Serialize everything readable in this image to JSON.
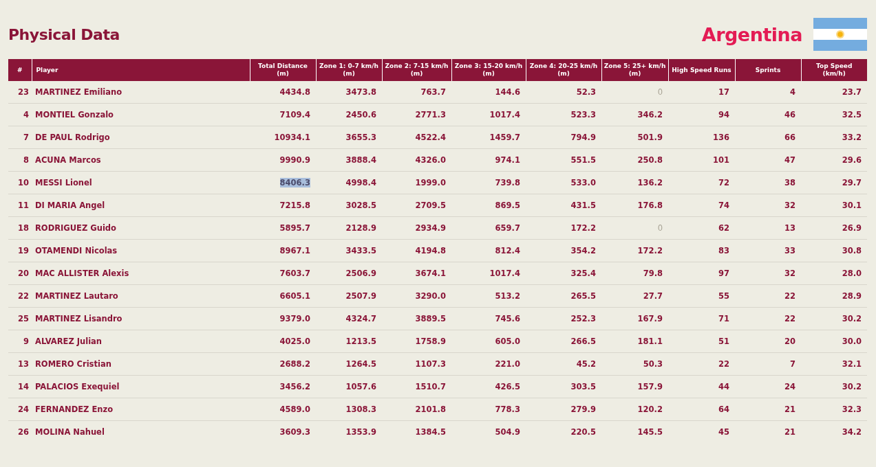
{
  "title": "Physical Data",
  "team": {
    "name": "Argentina"
  },
  "table": {
    "columns": [
      "#",
      "Player",
      "Total Distance\n(m)",
      "Zone 1: 0-7 km/h\n(m)",
      "Zone 2: 7-15 km/h\n(m)",
      "Zone 3: 15-20 km/h\n(m)",
      "Zone 4: 20-25 km/h\n(m)",
      "Zone 5: 25+ km/h\n(m)",
      "High Speed Runs",
      "Sprints",
      "Top Speed\n(km/h)"
    ],
    "rows": [
      {
        "number": "23",
        "player": "MARTINEZ Emiliano",
        "values": [
          "4434.8",
          "3473.8",
          "763.7",
          "144.6",
          "52.3",
          "0",
          "17",
          "4",
          "23.7"
        ],
        "zone5_faded": true,
        "total_selected": false
      },
      {
        "number": "4",
        "player": "MONTIEL Gonzalo",
        "values": [
          "7109.4",
          "2450.6",
          "2771.3",
          "1017.4",
          "523.3",
          "346.2",
          "94",
          "46",
          "32.5"
        ],
        "zone5_faded": false,
        "total_selected": false
      },
      {
        "number": "7",
        "player": "DE PAUL Rodrigo",
        "values": [
          "10934.1",
          "3655.3",
          "4522.4",
          "1459.7",
          "794.9",
          "501.9",
          "136",
          "66",
          "33.2"
        ],
        "zone5_faded": false,
        "total_selected": false
      },
      {
        "number": "8",
        "player": "ACUNA Marcos",
        "values": [
          "9990.9",
          "3888.4",
          "4326.0",
          "974.1",
          "551.5",
          "250.8",
          "101",
          "47",
          "29.6"
        ],
        "zone5_faded": false,
        "total_selected": false
      },
      {
        "number": "10",
        "player": "MESSI Lionel",
        "values": [
          "8406.3",
          "4998.4",
          "1999.0",
          "739.8",
          "533.0",
          "136.2",
          "72",
          "38",
          "29.7"
        ],
        "zone5_faded": false,
        "total_selected": true
      },
      {
        "number": "11",
        "player": "DI MARIA Angel",
        "values": [
          "7215.8",
          "3028.5",
          "2709.5",
          "869.5",
          "431.5",
          "176.8",
          "74",
          "32",
          "30.1"
        ],
        "zone5_faded": false,
        "total_selected": false
      },
      {
        "number": "18",
        "player": "RODRIGUEZ Guido",
        "values": [
          "5895.7",
          "2128.9",
          "2934.9",
          "659.7",
          "172.2",
          "0",
          "62",
          "13",
          "26.9"
        ],
        "zone5_faded": true,
        "total_selected": false
      },
      {
        "number": "19",
        "player": "OTAMENDI Nicolas",
        "values": [
          "8967.1",
          "3433.5",
          "4194.8",
          "812.4",
          "354.2",
          "172.2",
          "83",
          "33",
          "30.8"
        ],
        "zone5_faded": false,
        "total_selected": false
      },
      {
        "number": "20",
        "player": "MAC ALLISTER Alexis",
        "values": [
          "7603.7",
          "2506.9",
          "3674.1",
          "1017.4",
          "325.4",
          "79.8",
          "97",
          "32",
          "28.0"
        ],
        "zone5_faded": false,
        "total_selected": false
      },
      {
        "number": "22",
        "player": "MARTINEZ Lautaro",
        "values": [
          "6605.1",
          "2507.9",
          "3290.0",
          "513.2",
          "265.5",
          "27.7",
          "55",
          "22",
          "28.9"
        ],
        "zone5_faded": false,
        "total_selected": false
      },
      {
        "number": "25",
        "player": "MARTINEZ Lisandro",
        "values": [
          "9379.0",
          "4324.7",
          "3889.5",
          "745.6",
          "252.3",
          "167.9",
          "71",
          "22",
          "30.2"
        ],
        "zone5_faded": false,
        "total_selected": false
      },
      {
        "number": "9",
        "player": "ALVAREZ Julian",
        "values": [
          "4025.0",
          "1213.5",
          "1758.9",
          "605.0",
          "266.5",
          "181.1",
          "51",
          "20",
          "30.0"
        ],
        "zone5_faded": false,
        "total_selected": false
      },
      {
        "number": "13",
        "player": "ROMERO Cristian",
        "values": [
          "2688.2",
          "1264.5",
          "1107.3",
          "221.0",
          "45.2",
          "50.3",
          "22",
          "7",
          "32.1"
        ],
        "zone5_faded": false,
        "total_selected": false
      },
      {
        "number": "14",
        "player": "PALACIOS Exequiel",
        "values": [
          "3456.2",
          "1057.6",
          "1510.7",
          "426.5",
          "303.5",
          "157.9",
          "44",
          "24",
          "30.2"
        ],
        "zone5_faded": false,
        "total_selected": false
      },
      {
        "number": "24",
        "player": "FERNANDEZ Enzo",
        "values": [
          "4589.0",
          "1308.3",
          "2101.8",
          "778.3",
          "279.9",
          "120.2",
          "64",
          "21",
          "32.3"
        ],
        "zone5_faded": false,
        "total_selected": false
      },
      {
        "number": "26",
        "player": "MOLINA Nahuel",
        "values": [
          "3609.3",
          "1353.9",
          "1384.5",
          "504.9",
          "220.5",
          "145.5",
          "45",
          "21",
          "34.2"
        ],
        "zone5_faded": false,
        "total_selected": false
      }
    ]
  }
}
